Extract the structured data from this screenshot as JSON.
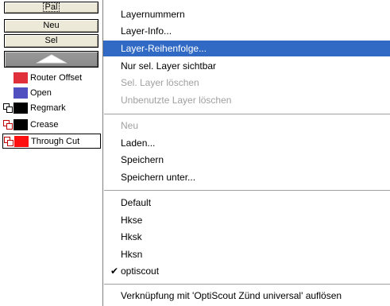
{
  "layer_panel": {
    "buttons": {
      "pal": "Pal",
      "neu": "Neu",
      "sel": "Sel"
    },
    "layers": [
      {
        "name": "Router Offset",
        "color": "#e0303c",
        "locked": false,
        "active": false
      },
      {
        "name": "Open",
        "color": "#5050c0",
        "locked": false,
        "active": false
      },
      {
        "name": "Regmark",
        "color": "#000000",
        "locked": true,
        "active": false
      },
      {
        "name": "Crease",
        "color": "#000000",
        "locked": true,
        "active": false
      },
      {
        "name": "Through Cut",
        "color": "#ff1010",
        "locked": true,
        "active": true
      }
    ]
  },
  "context_menu": {
    "items": [
      {
        "label": "Layernummern",
        "state": "normal"
      },
      {
        "label": "Layer-Info...",
        "state": "normal"
      },
      {
        "label": "Layer-Reihenfolge...",
        "state": "highlighted"
      },
      {
        "label": "Nur sel. Layer sichtbar",
        "state": "normal"
      },
      {
        "label": "Sel. Layer löschen",
        "state": "disabled"
      },
      {
        "label": "Unbenutzte Layer löschen",
        "state": "disabled"
      },
      {
        "label": "Neu",
        "state": "disabled"
      },
      {
        "label": "Laden...",
        "state": "normal"
      },
      {
        "label": "Speichern",
        "state": "normal"
      },
      {
        "label": "Speichern unter...",
        "state": "normal"
      },
      {
        "label": "Default",
        "state": "normal"
      },
      {
        "label": "Hkse",
        "state": "normal"
      },
      {
        "label": "Hksk",
        "state": "normal"
      },
      {
        "label": "Hksn",
        "state": "normal"
      },
      {
        "label": "optiscout",
        "state": "checked"
      },
      {
        "label": "Verknüpfung mit 'OptiScout Zünd universal' auflösen",
        "state": "normal"
      }
    ],
    "highlight_color": "#316ac5",
    "disabled_color": "#a0a0a0"
  }
}
